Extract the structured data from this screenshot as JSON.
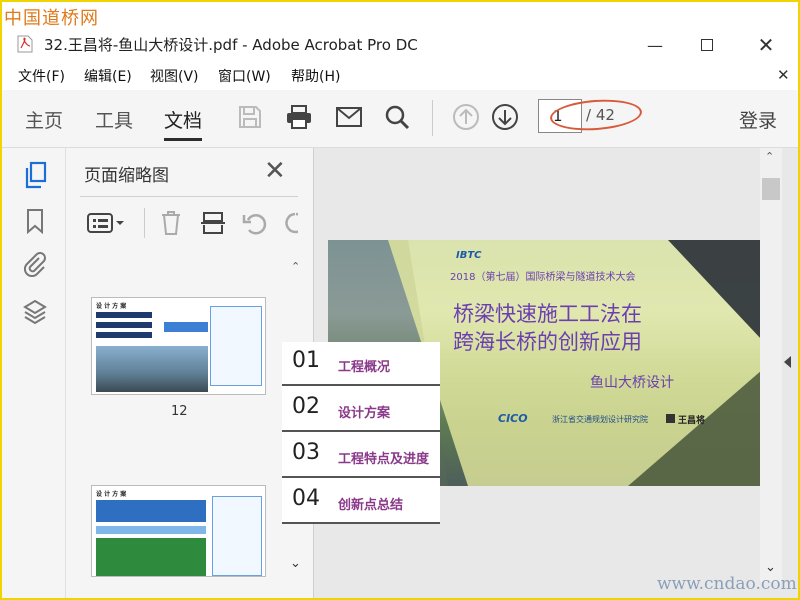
{
  "watermark": {
    "top": "中国道桥网",
    "bottom": "www.cndao.com"
  },
  "window": {
    "title": "32.王昌将-鱼山大桥设计.pdf - Adobe Acrobat Pro DC"
  },
  "menu": [
    "文件(F)",
    "编辑(E)",
    "视图(V)",
    "窗口(W)",
    "帮助(H)"
  ],
  "toolbar": {
    "tabs": [
      "主页",
      "工具",
      "文档"
    ],
    "active_tab": "文档",
    "page_current": "1",
    "page_total": "/ 42",
    "login": "登录"
  },
  "thumbnails": {
    "title": "页面缩略图",
    "items": [
      {
        "page_label": "12",
        "heading": "设 计 方 案"
      },
      {
        "page_label": "",
        "heading": "设 计 方 案"
      }
    ]
  },
  "slide": {
    "logo": "IBTC",
    "conference": "2018（第七届）国际桥梁与隧道技术大会",
    "title_line1": "桥梁快速施工工法在",
    "title_line2": "跨海长桥的创新应用",
    "subtitle": "鱼山大桥设计",
    "org_logo": "CICO",
    "org": "浙江省交通规划设计研究院",
    "author": "王昌将"
  },
  "agenda": [
    {
      "num": "01",
      "label": "工程概况"
    },
    {
      "num": "02",
      "label": "设计方案"
    },
    {
      "num": "03",
      "label": "工程特点及进度"
    },
    {
      "num": "04",
      "label": "创新点总结"
    }
  ],
  "colors": {
    "frame": "#f0d400",
    "annotation": "#d85a3a",
    "agenda_text": "#8a3a8a",
    "slide_title": "#6b3fb0"
  }
}
